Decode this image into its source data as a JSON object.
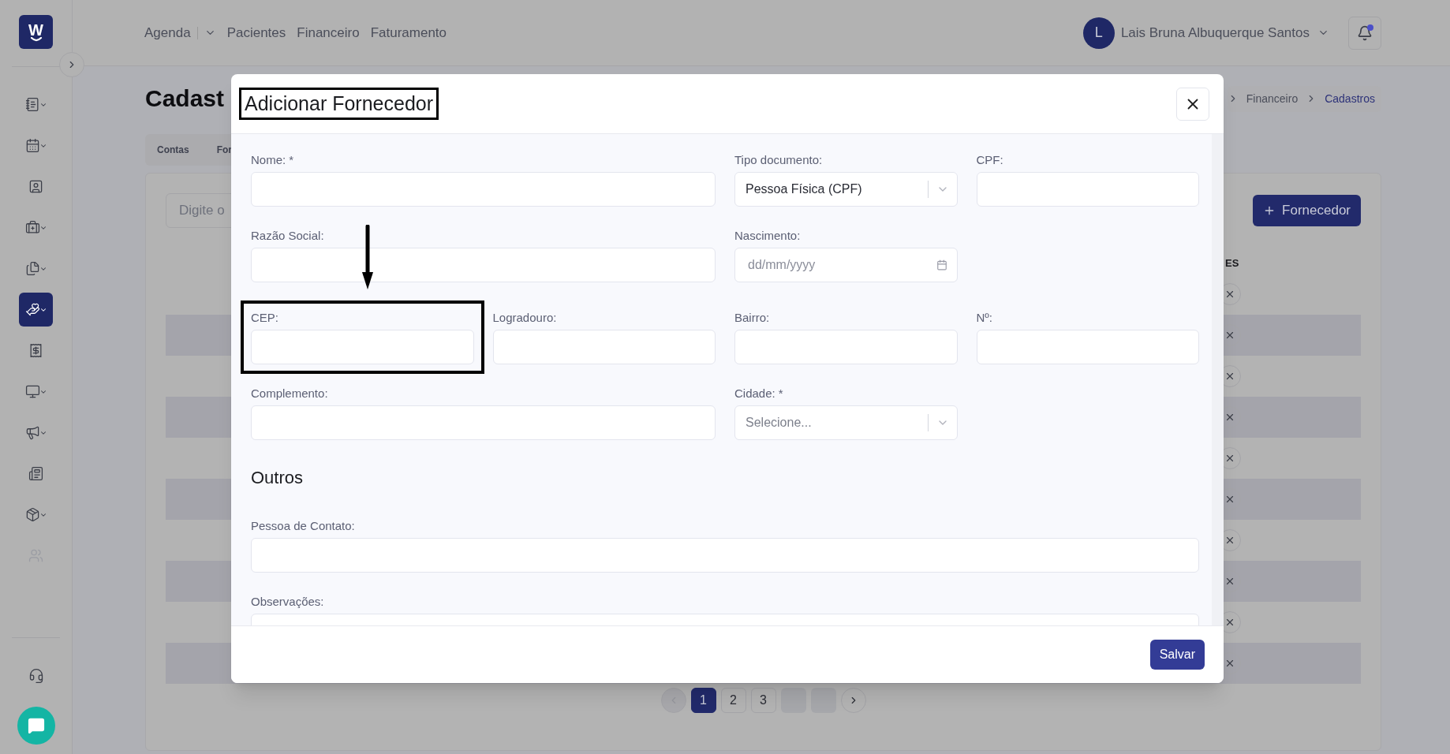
{
  "sidebar": {
    "logo": "W",
    "items": [
      {
        "selected": false,
        "submenu": true,
        "disabled": false
      },
      {
        "selected": false,
        "submenu": true,
        "disabled": false
      },
      {
        "selected": false,
        "submenu": false,
        "disabled": false
      },
      {
        "selected": false,
        "submenu": true,
        "disabled": false
      },
      {
        "selected": false,
        "submenu": true,
        "disabled": false
      },
      {
        "selected": true,
        "submenu": true,
        "disabled": false
      },
      {
        "selected": false,
        "submenu": false,
        "disabled": false
      },
      {
        "selected": false,
        "submenu": true,
        "disabled": false
      },
      {
        "selected": false,
        "submenu": true,
        "disabled": false
      },
      {
        "selected": false,
        "submenu": false,
        "disabled": false
      },
      {
        "selected": false,
        "submenu": true,
        "disabled": false
      },
      {
        "selected": false,
        "submenu": false,
        "disabled": true
      }
    ]
  },
  "header": {
    "nav": [
      {
        "label": "Agenda",
        "dropdown": true
      },
      {
        "label": "Pacientes",
        "dropdown": false
      },
      {
        "label": "Financeiro",
        "dropdown": false
      },
      {
        "label": "Faturamento",
        "dropdown": false
      }
    ],
    "user": {
      "initial": "L",
      "name": "Lais Bruna Albuquerque Santos"
    },
    "notifications": {
      "unread": true
    }
  },
  "page": {
    "title": "Cadast",
    "breadcrumb": [
      {
        "label": "Financeiro",
        "current": false
      },
      {
        "label": "Cadastros",
        "current": true
      }
    ],
    "tabs": [
      {
        "label": "Contas"
      },
      {
        "label": "For"
      }
    ],
    "search": {
      "placeholder": "Digite o"
    },
    "add_button": "Fornecedor",
    "table": {
      "column_header": "ES",
      "rows": [
        {
          "striped": false
        },
        {
          "striped": true
        },
        {
          "striped": false
        },
        {
          "striped": true
        },
        {
          "striped": false
        },
        {
          "striped": true
        },
        {
          "striped": false
        },
        {
          "striped": true
        },
        {
          "striped": false
        },
        {
          "striped": true
        }
      ]
    },
    "pagination": [
      {
        "kind": "prev",
        "disabled": true
      },
      {
        "kind": "page",
        "label": "1",
        "selected": true
      },
      {
        "kind": "page",
        "label": "2",
        "selected": false
      },
      {
        "kind": "page",
        "label": "3",
        "selected": false
      },
      {
        "kind": "blank"
      },
      {
        "kind": "blank"
      },
      {
        "kind": "next",
        "disabled": false
      }
    ]
  },
  "modal": {
    "title": "Adicionar Fornecedor",
    "fields": [
      {
        "label": "Nome: *",
        "kind": "text"
      },
      {
        "label": "Tipo documento:",
        "kind": "select",
        "value": "Pessoa Física (CPF)"
      },
      {
        "label": "CPF:",
        "kind": "text"
      },
      {
        "label": "Razão Social:",
        "kind": "text"
      },
      {
        "label": "Nascimento:",
        "kind": "date",
        "placeholder": "dd/mm/yyyy"
      },
      {
        "label": "CEP:",
        "kind": "text"
      },
      {
        "label": "Logradouro:",
        "kind": "text"
      },
      {
        "label": "Bairro:",
        "kind": "text"
      },
      {
        "label": "Nº:",
        "kind": "text"
      },
      {
        "label": "Complemento:",
        "kind": "text"
      },
      {
        "label": "Cidade: *",
        "kind": "select",
        "placeholder": "Selecione..."
      }
    ],
    "section_title": "Outros",
    "other_fields": [
      {
        "label": "Pessoa de Contato:",
        "kind": "text"
      },
      {
        "label": "Observações:",
        "kind": "textarea"
      }
    ],
    "save_button": "Salvar"
  }
}
